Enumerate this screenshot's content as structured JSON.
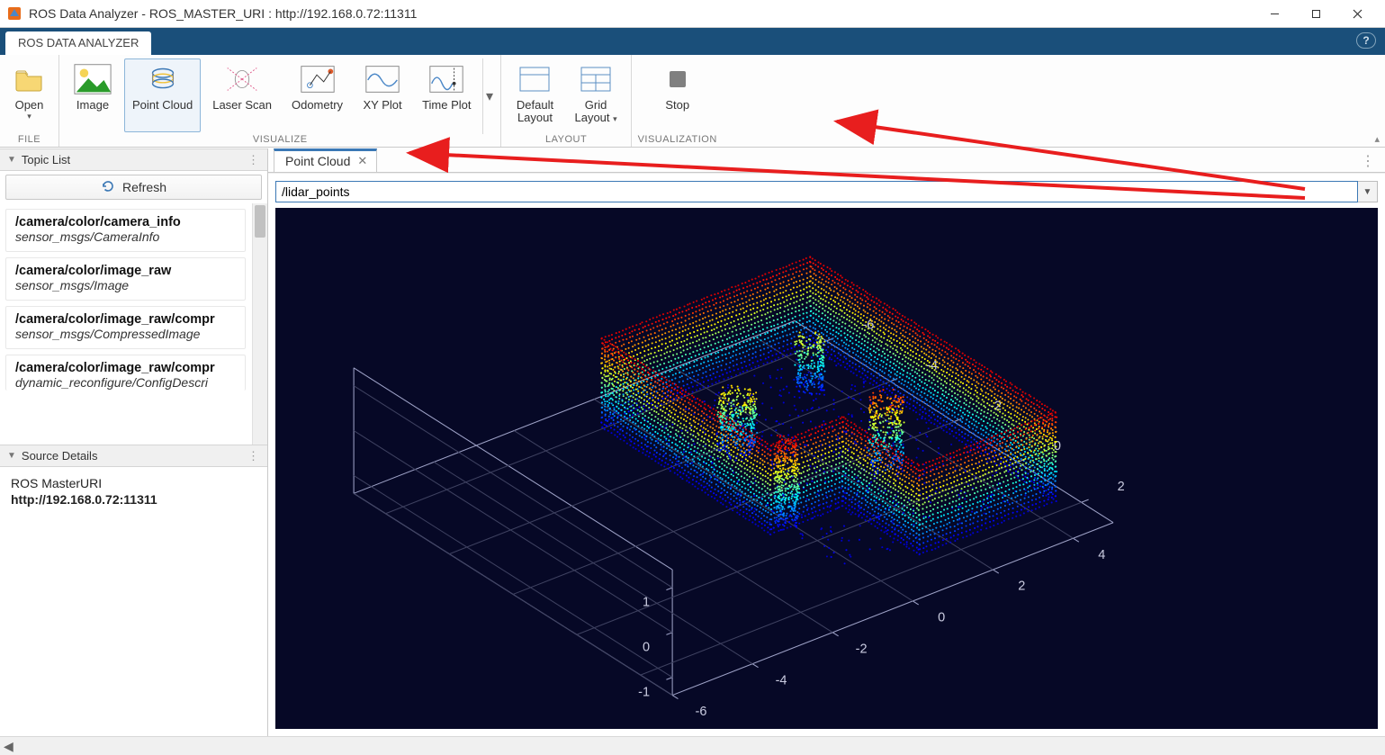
{
  "window": {
    "title": "ROS Data Analyzer - ROS_MASTER_URI : http://192.168.0.72:11311"
  },
  "ribbon": {
    "tab": "ROS DATA ANALYZER"
  },
  "toolstrip": {
    "file": {
      "open": "Open",
      "dd": "▾",
      "label": "FILE"
    },
    "visualize": {
      "image": "Image",
      "pointcloud": "Point Cloud",
      "laserscan": "Laser Scan",
      "odometry": "Odometry",
      "xyplot": "XY Plot",
      "timeplot": "Time Plot",
      "label": "VISUALIZE"
    },
    "layout": {
      "default": "Default\nLayout",
      "grid": "Grid\nLayout",
      "dd": "▾",
      "label": "LAYOUT"
    },
    "visualization": {
      "stop": "Stop",
      "label": "VISUALIZATION"
    }
  },
  "sidebar": {
    "topiclist_title": "Topic List",
    "refresh": "Refresh",
    "topics": [
      {
        "name": "/camera/color/camera_info",
        "type": "sensor_msgs/CameraInfo"
      },
      {
        "name": "/camera/color/image_raw",
        "type": "sensor_msgs/Image"
      },
      {
        "name": "/camera/color/image_raw/compr",
        "type": "sensor_msgs/CompressedImage"
      },
      {
        "name": "/camera/color/image_raw/compr",
        "type": "dynamic_reconfigure/ConfigDescri"
      }
    ],
    "source_title": "Source Details",
    "source_key": "ROS MasterURI",
    "source_val": "http://192.168.0.72:11311"
  },
  "doc": {
    "tab": "Point Cloud",
    "topic": "/lidar_points"
  },
  "chart_data": {
    "type": "scatter3d",
    "title": "",
    "axes": {
      "x_ticks": [
        -6,
        -4,
        -2,
        0,
        2,
        4
      ],
      "y_ticks": [
        -6,
        -4,
        -2,
        0,
        2
      ],
      "z_ticks": [
        -1,
        0,
        1
      ]
    },
    "colormap": "jet",
    "description": "LiDAR point cloud, horizontal scan rings of an indoor room, colored by height(z)",
    "z_range": [
      -1.2,
      1.2
    ],
    "approx_point_count": 15000
  }
}
